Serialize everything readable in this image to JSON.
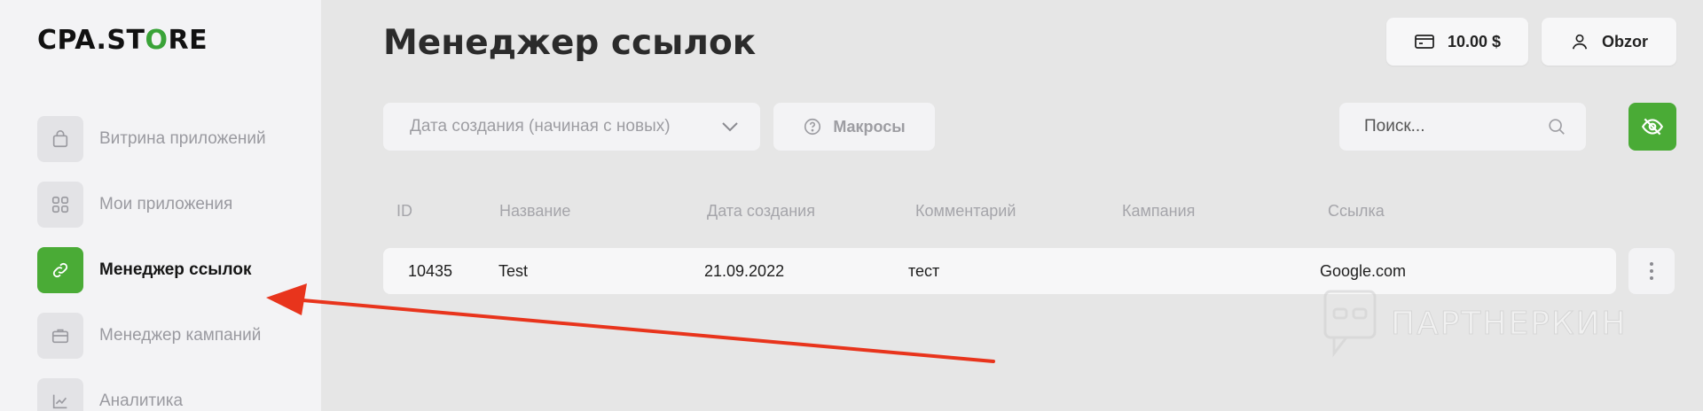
{
  "sidebar": {
    "logo_main": "CPA.ST",
    "logo_accent": "O",
    "logo_tail": "RE",
    "items": [
      {
        "label": "Витрина приложений",
        "icon": "shopping-bag-icon",
        "active": false
      },
      {
        "label": "Мои приложения",
        "icon": "grid-icon",
        "active": false
      },
      {
        "label": "Менеджер ссылок",
        "icon": "link-icon",
        "active": true
      },
      {
        "label": "Менеджер кампаний",
        "icon": "briefcase-icon",
        "active": false
      },
      {
        "label": "Аналитика",
        "icon": "chart-icon",
        "active": false
      }
    ]
  },
  "header": {
    "title": "Менеджер ссылок",
    "balance": "10.00 $",
    "user": "Obzor"
  },
  "filters": {
    "sort_value": "Дата создания (начиная с новых)",
    "macros_label": "Макросы",
    "search_placeholder": "Поиск..."
  },
  "table": {
    "columns": [
      "ID",
      "Название",
      "Дата создания",
      "Комментарий",
      "Кампания",
      "Ссылка"
    ],
    "rows": [
      {
        "id": "10435",
        "name": "Test",
        "created": "21.09.2022",
        "comment": "тест",
        "campaign": "",
        "link": "Google.com"
      }
    ]
  },
  "watermark": "ПАРТНЕРКИН",
  "colors": {
    "accent": "#4aab36",
    "arrow": "#e8341c",
    "sidebar_bg": "#f3f3f5",
    "page_bg": "#e6e6e6"
  }
}
